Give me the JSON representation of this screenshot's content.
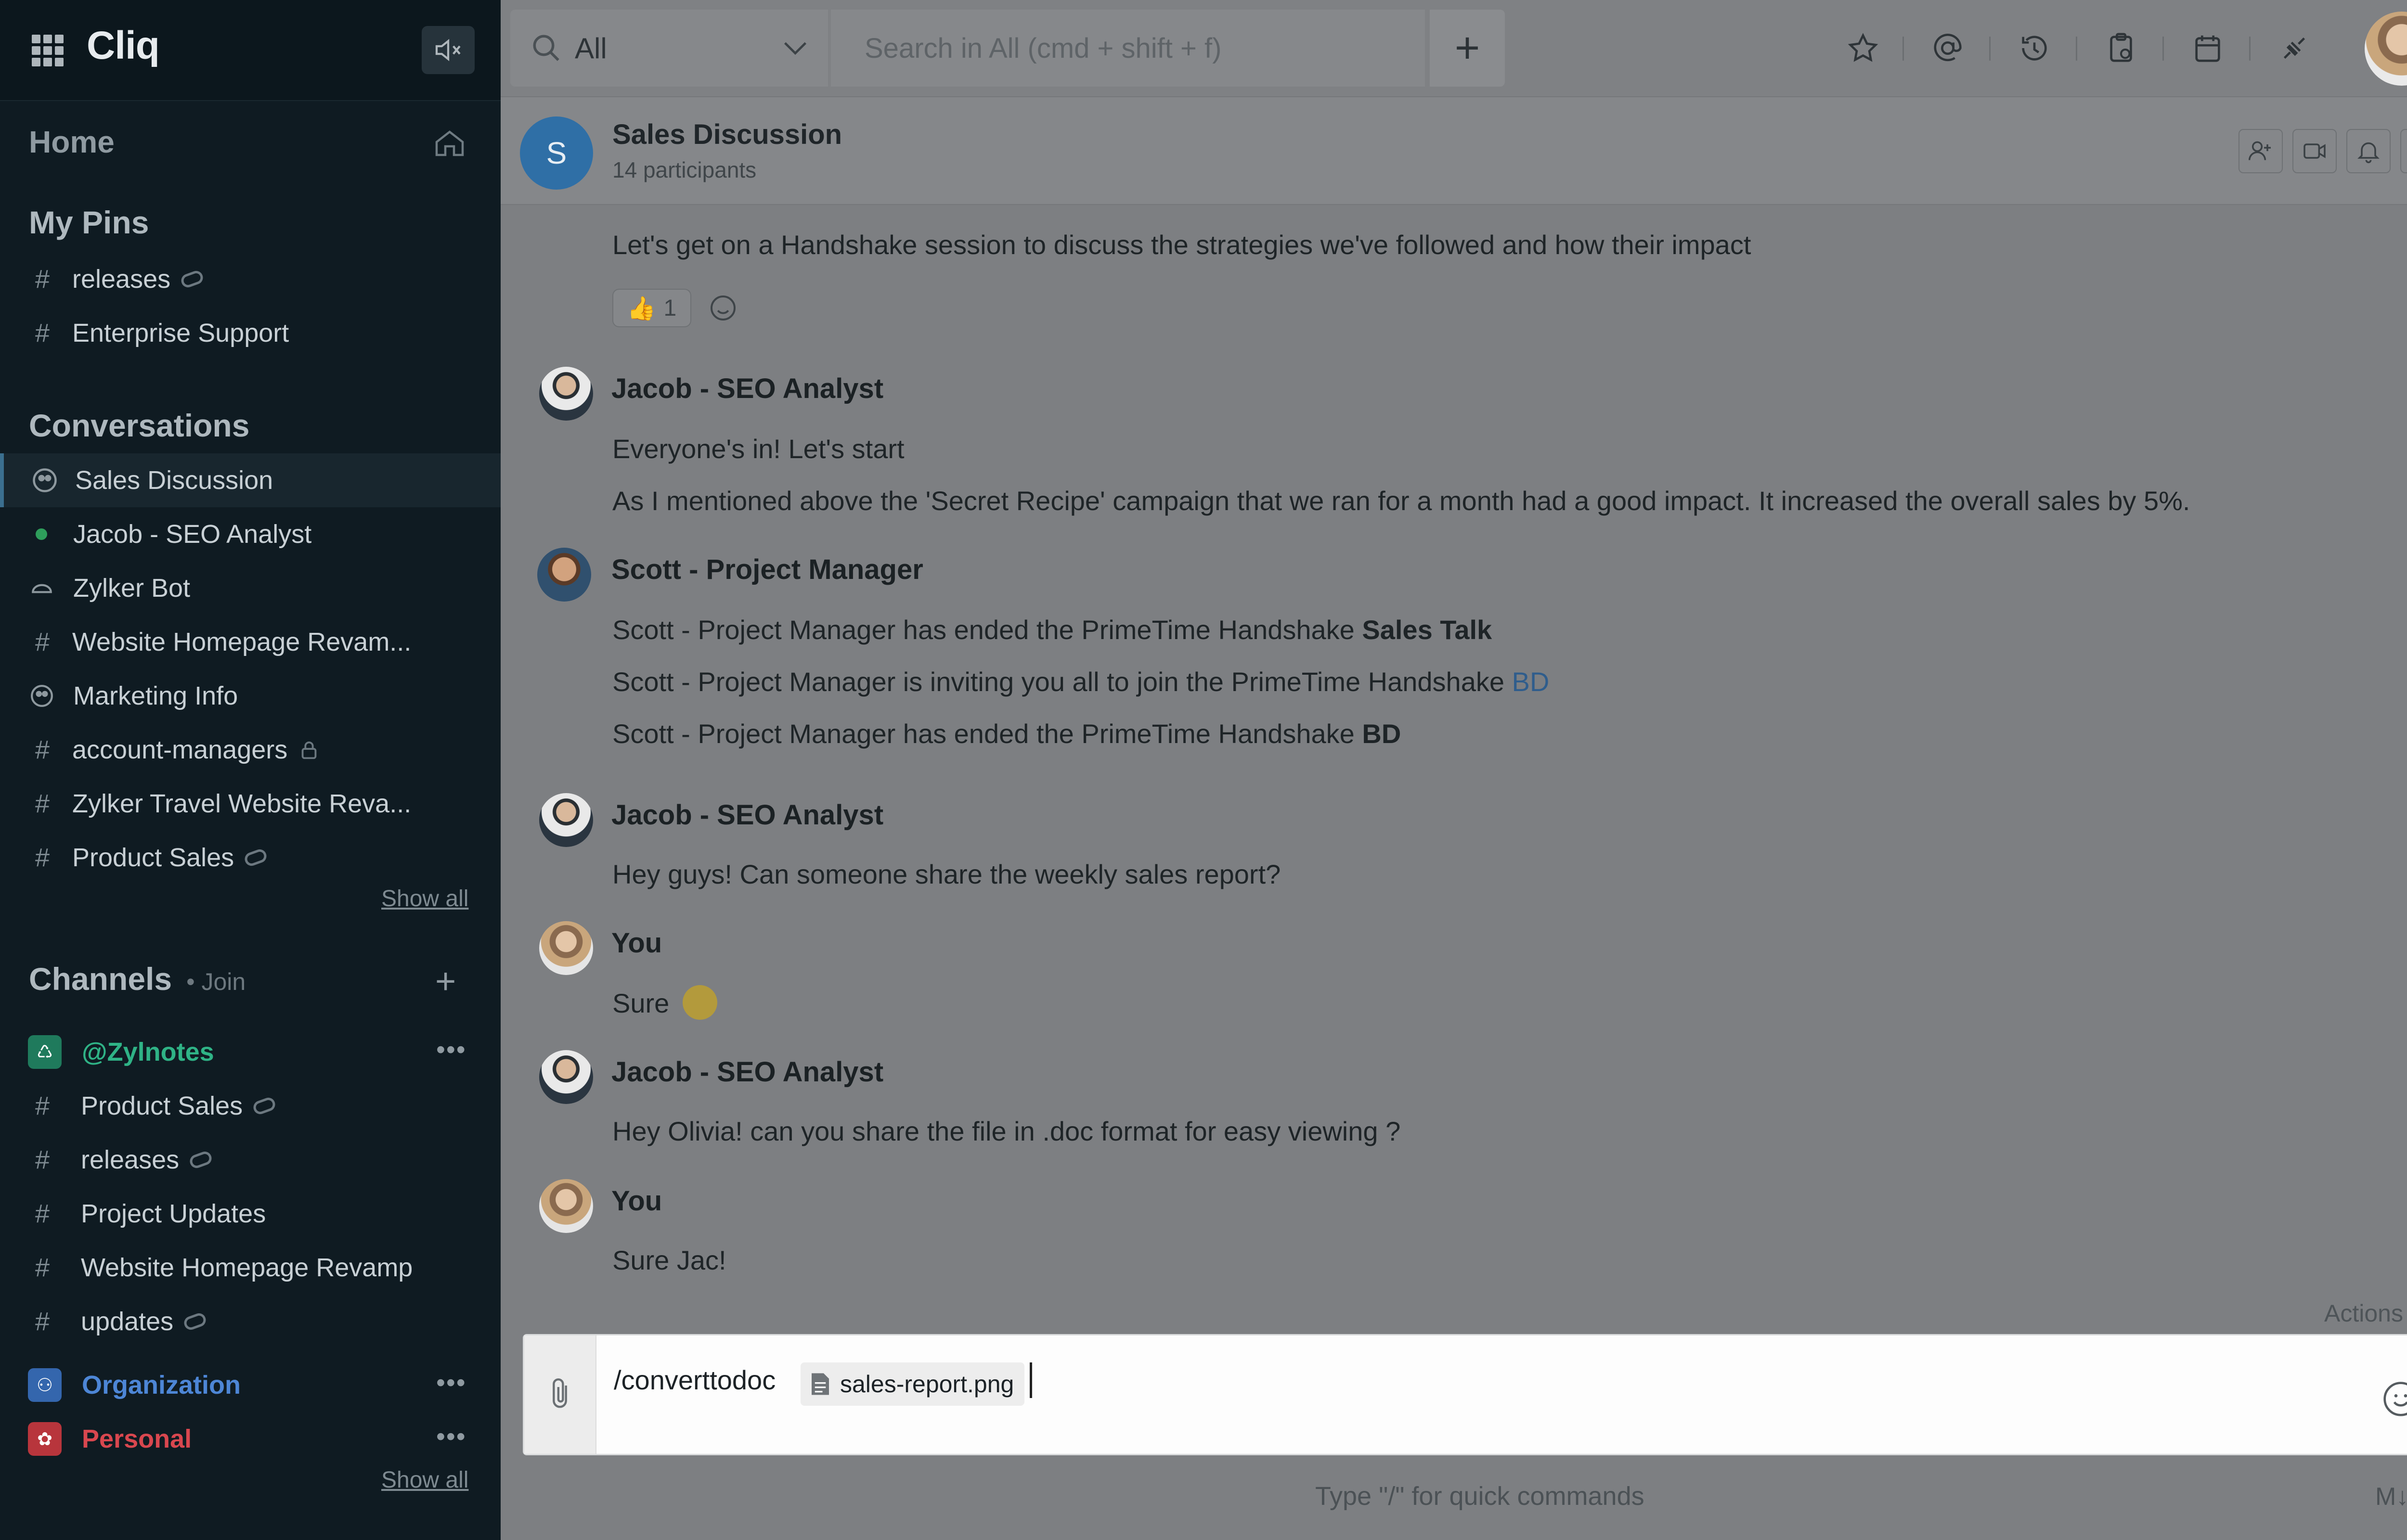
{
  "app": {
    "name": "Cliq"
  },
  "sidebar": {
    "home_label": "Home",
    "pins_title": "My Pins",
    "pins": [
      {
        "label": "releases",
        "icon": "hash-icon",
        "linked": true
      },
      {
        "label": "Enterprise Support",
        "icon": "hash-icon",
        "linked": false
      }
    ],
    "conversations_title": "Conversations",
    "conversations": [
      {
        "label": "Sales Discussion",
        "icon": "group-icon",
        "active": true
      },
      {
        "label": "Jacob -  SEO Analyst",
        "icon": "online-dot-icon"
      },
      {
        "label": "Zylker Bot",
        "icon": "bot-icon"
      },
      {
        "label": "Website Homepage Revam...",
        "icon": "hash-icon"
      },
      {
        "label": "Marketing Info",
        "icon": "group-icon"
      },
      {
        "label": "account-managers",
        "icon": "hash-icon",
        "locked": true
      },
      {
        "label": "Zylker Travel Website Reva...",
        "icon": "hash-icon"
      },
      {
        "label": "Product Sales",
        "icon": "hash-icon",
        "linked": true
      }
    ],
    "show_all": "Show all",
    "channels_title": "Channels",
    "channels_join": "• Join",
    "channels": [
      {
        "label": "@Zylnotes",
        "icon": "zylnotes-icon",
        "color": "#2fa37a"
      },
      {
        "label": "Product Sales",
        "icon": "hash-icon",
        "linked": true
      },
      {
        "label": "releases",
        "icon": "hash-icon",
        "linked": true
      },
      {
        "label": "Project Updates",
        "icon": "hash-icon"
      },
      {
        "label": "Website Homepage Revamp",
        "icon": "hash-icon"
      },
      {
        "label": "updates",
        "icon": "hash-icon",
        "linked": true
      }
    ],
    "orgs": [
      {
        "label": "Organization",
        "color": "#3d6fb6"
      },
      {
        "label": "Personal",
        "color": "#c6383f"
      }
    ],
    "show_all_2": "Show all"
  },
  "topbar": {
    "scope": "All",
    "search_placeholder": "Search in All (cmd + shift + f)",
    "icons": [
      "star-icon",
      "at-icon",
      "history-icon",
      "clipboard-icon",
      "calendar-icon",
      "integrations-icon"
    ]
  },
  "chat": {
    "avatar_letter": "S",
    "title": "Sales Discussion",
    "participants": "14 participants",
    "messages": {
      "m0": "Let's get on a Handshake session to discuss the strategies we've followed and how their impact",
      "reaction_count": "1",
      "jacob": "Jacob -  SEO Analyst",
      "m1": "Everyone's in! Let's start",
      "m2": "As I mentioned above the 'Secret Recipe' campaign that we ran for a month had a good impact. It increased the overall sales by 5%.",
      "scott": "Scott -  Project  Manager",
      "m3a": "Scott - Project Manager has ended the PrimeTime Handshake ",
      "m3b": "Sales Talk",
      "m4a": "Scott - Project Manager is inviting you all to join the PrimeTime Handshake ",
      "m4b": "BD",
      "m5a": "Scott - Project Manager has ended the PrimeTime Handshake ",
      "m5b": "BD",
      "m6": "Hey guys! Can someone share the weekly sales report?",
      "you": "You",
      "m7": "Sure",
      "m8": "Hey Olivia! can you share the file in .doc format for easy viewing ?",
      "m9": "Sure Jac!"
    },
    "actions_label": "Actions"
  },
  "composer": {
    "command": "/converttodoc",
    "attachment": "sales-report.png",
    "hint": "Type \"/\" for quick commands",
    "markdown": "M↓"
  }
}
